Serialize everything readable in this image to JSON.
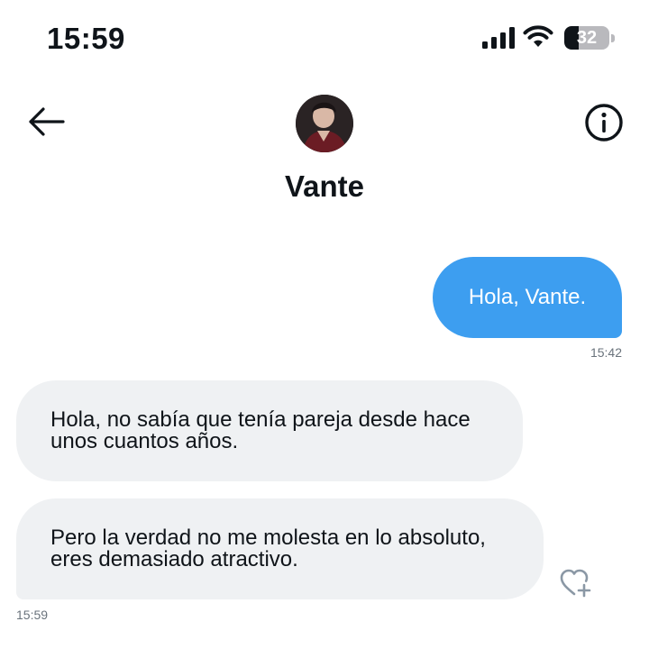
{
  "status_bar": {
    "time": "15:59",
    "battery_level": "32",
    "battery_fraction": 0.32,
    "icons": [
      "cellular-signal-icon",
      "wifi-icon",
      "battery-icon"
    ]
  },
  "header": {
    "contact_name": "Vante",
    "back_icon": "arrow-left-icon",
    "info_icon": "info-circle-icon"
  },
  "messages": [
    {
      "direction": "outgoing",
      "text": "Hola, Vante.",
      "time": "15:42"
    },
    {
      "direction": "incoming",
      "text": "Hola, no sabía que tenía pareja desde hace unos cuantos años."
    },
    {
      "direction": "incoming",
      "text": "Pero la verdad no me molesta en lo absoluto, eres demasiado atractivo.",
      "time": "15:59"
    }
  ],
  "colors": {
    "outgoing_bubble": "#3d9ef0",
    "incoming_bubble": "#eff1f3",
    "timestamp": "#6a737c"
  }
}
